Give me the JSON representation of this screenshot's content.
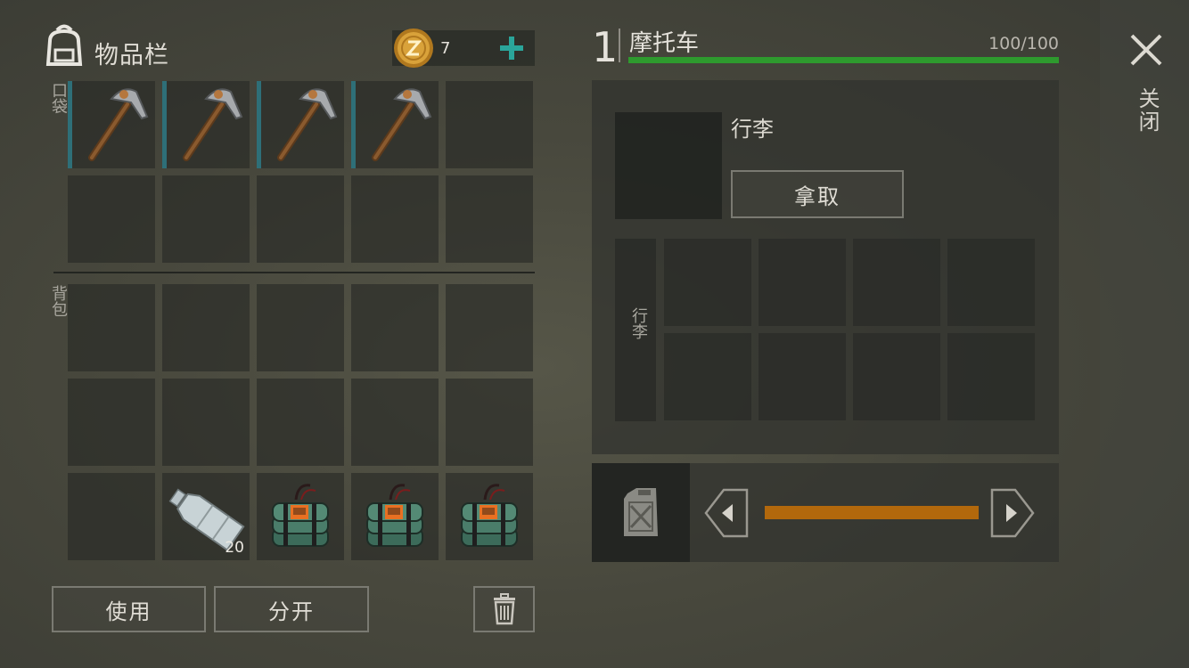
{
  "inventory": {
    "title": "物品栏",
    "coins": "7",
    "pocket_label": "口袋",
    "backpack_label": "背包",
    "pocket_slots": [
      {
        "item": "pickaxe-icon",
        "highlight": true
      },
      {
        "item": "pickaxe-icon",
        "highlight": true
      },
      {
        "item": "pickaxe-icon",
        "highlight": true
      },
      {
        "item": "pickaxe-icon",
        "highlight": true
      },
      {
        "item": "",
        "highlight": false
      },
      {
        "item": "",
        "highlight": false
      },
      {
        "item": "",
        "highlight": false
      },
      {
        "item": "",
        "highlight": false
      },
      {
        "item": "",
        "highlight": false
      },
      {
        "item": "",
        "highlight": false
      }
    ],
    "backpack_slots": [
      {
        "item": ""
      },
      {
        "item": ""
      },
      {
        "item": ""
      },
      {
        "item": ""
      },
      {
        "item": ""
      },
      {
        "item": ""
      },
      {
        "item": ""
      },
      {
        "item": ""
      },
      {
        "item": ""
      },
      {
        "item": ""
      },
      {
        "item": ""
      },
      {
        "item": "water-bottle-icon",
        "count": "20"
      },
      {
        "item": "c4-explosive-icon"
      },
      {
        "item": "c4-explosive-icon"
      },
      {
        "item": "c4-explosive-icon"
      }
    ],
    "use_label": "使用",
    "split_label": "分开"
  },
  "vehicle": {
    "number": "1",
    "name": "摩托车",
    "hp_text": "100/100",
    "hp_fraction": 1.0,
    "luggage_title": "行李",
    "take_label": "拿取",
    "storage_label": "行李",
    "fuel_fraction": 1.0
  },
  "close_label": "关闭",
  "colors": {
    "hp_bar": "#2e9a2e",
    "fuel_bar": "#b2680c",
    "pocket_highlight": "#2e6f78",
    "add_button": "#2aa59a"
  }
}
